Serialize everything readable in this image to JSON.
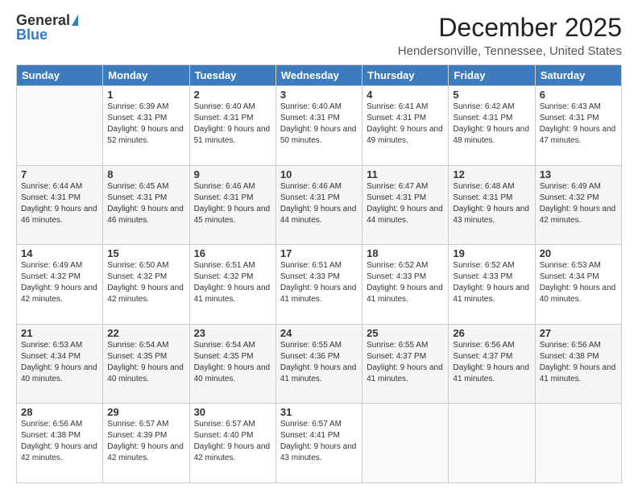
{
  "logo": {
    "general": "General",
    "blue": "Blue"
  },
  "title": "December 2025",
  "location": "Hendersonville, Tennessee, United States",
  "weekdays": [
    "Sunday",
    "Monday",
    "Tuesday",
    "Wednesday",
    "Thursday",
    "Friday",
    "Saturday"
  ],
  "weeks": [
    [
      {
        "day": "",
        "sunrise": "",
        "sunset": "",
        "daylight": ""
      },
      {
        "day": "1",
        "sunrise": "Sunrise: 6:39 AM",
        "sunset": "Sunset: 4:31 PM",
        "daylight": "Daylight: 9 hours and 52 minutes."
      },
      {
        "day": "2",
        "sunrise": "Sunrise: 6:40 AM",
        "sunset": "Sunset: 4:31 PM",
        "daylight": "Daylight: 9 hours and 51 minutes."
      },
      {
        "day": "3",
        "sunrise": "Sunrise: 6:40 AM",
        "sunset": "Sunset: 4:31 PM",
        "daylight": "Daylight: 9 hours and 50 minutes."
      },
      {
        "day": "4",
        "sunrise": "Sunrise: 6:41 AM",
        "sunset": "Sunset: 4:31 PM",
        "daylight": "Daylight: 9 hours and 49 minutes."
      },
      {
        "day": "5",
        "sunrise": "Sunrise: 6:42 AM",
        "sunset": "Sunset: 4:31 PM",
        "daylight": "Daylight: 9 hours and 48 minutes."
      },
      {
        "day": "6",
        "sunrise": "Sunrise: 6:43 AM",
        "sunset": "Sunset: 4:31 PM",
        "daylight": "Daylight: 9 hours and 47 minutes."
      }
    ],
    [
      {
        "day": "7",
        "sunrise": "Sunrise: 6:44 AM",
        "sunset": "Sunset: 4:31 PM",
        "daylight": "Daylight: 9 hours and 46 minutes."
      },
      {
        "day": "8",
        "sunrise": "Sunrise: 6:45 AM",
        "sunset": "Sunset: 4:31 PM",
        "daylight": "Daylight: 9 hours and 46 minutes."
      },
      {
        "day": "9",
        "sunrise": "Sunrise: 6:46 AM",
        "sunset": "Sunset: 4:31 PM",
        "daylight": "Daylight: 9 hours and 45 minutes."
      },
      {
        "day": "10",
        "sunrise": "Sunrise: 6:46 AM",
        "sunset": "Sunset: 4:31 PM",
        "daylight": "Daylight: 9 hours and 44 minutes."
      },
      {
        "day": "11",
        "sunrise": "Sunrise: 6:47 AM",
        "sunset": "Sunset: 4:31 PM",
        "daylight": "Daylight: 9 hours and 44 minutes."
      },
      {
        "day": "12",
        "sunrise": "Sunrise: 6:48 AM",
        "sunset": "Sunset: 4:31 PM",
        "daylight": "Daylight: 9 hours and 43 minutes."
      },
      {
        "day": "13",
        "sunrise": "Sunrise: 6:49 AM",
        "sunset": "Sunset: 4:32 PM",
        "daylight": "Daylight: 9 hours and 42 minutes."
      }
    ],
    [
      {
        "day": "14",
        "sunrise": "Sunrise: 6:49 AM",
        "sunset": "Sunset: 4:32 PM",
        "daylight": "Daylight: 9 hours and 42 minutes."
      },
      {
        "day": "15",
        "sunrise": "Sunrise: 6:50 AM",
        "sunset": "Sunset: 4:32 PM",
        "daylight": "Daylight: 9 hours and 42 minutes."
      },
      {
        "day": "16",
        "sunrise": "Sunrise: 6:51 AM",
        "sunset": "Sunset: 4:32 PM",
        "daylight": "Daylight: 9 hours and 41 minutes."
      },
      {
        "day": "17",
        "sunrise": "Sunrise: 6:51 AM",
        "sunset": "Sunset: 4:33 PM",
        "daylight": "Daylight: 9 hours and 41 minutes."
      },
      {
        "day": "18",
        "sunrise": "Sunrise: 6:52 AM",
        "sunset": "Sunset: 4:33 PM",
        "daylight": "Daylight: 9 hours and 41 minutes."
      },
      {
        "day": "19",
        "sunrise": "Sunrise: 6:52 AM",
        "sunset": "Sunset: 4:33 PM",
        "daylight": "Daylight: 9 hours and 41 minutes."
      },
      {
        "day": "20",
        "sunrise": "Sunrise: 6:53 AM",
        "sunset": "Sunset: 4:34 PM",
        "daylight": "Daylight: 9 hours and 40 minutes."
      }
    ],
    [
      {
        "day": "21",
        "sunrise": "Sunrise: 6:53 AM",
        "sunset": "Sunset: 4:34 PM",
        "daylight": "Daylight: 9 hours and 40 minutes."
      },
      {
        "day": "22",
        "sunrise": "Sunrise: 6:54 AM",
        "sunset": "Sunset: 4:35 PM",
        "daylight": "Daylight: 9 hours and 40 minutes."
      },
      {
        "day": "23",
        "sunrise": "Sunrise: 6:54 AM",
        "sunset": "Sunset: 4:35 PM",
        "daylight": "Daylight: 9 hours and 40 minutes."
      },
      {
        "day": "24",
        "sunrise": "Sunrise: 6:55 AM",
        "sunset": "Sunset: 4:36 PM",
        "daylight": "Daylight: 9 hours and 41 minutes."
      },
      {
        "day": "25",
        "sunrise": "Sunrise: 6:55 AM",
        "sunset": "Sunset: 4:37 PM",
        "daylight": "Daylight: 9 hours and 41 minutes."
      },
      {
        "day": "26",
        "sunrise": "Sunrise: 6:56 AM",
        "sunset": "Sunset: 4:37 PM",
        "daylight": "Daylight: 9 hours and 41 minutes."
      },
      {
        "day": "27",
        "sunrise": "Sunrise: 6:56 AM",
        "sunset": "Sunset: 4:38 PM",
        "daylight": "Daylight: 9 hours and 41 minutes."
      }
    ],
    [
      {
        "day": "28",
        "sunrise": "Sunrise: 6:56 AM",
        "sunset": "Sunset: 4:38 PM",
        "daylight": "Daylight: 9 hours and 42 minutes."
      },
      {
        "day": "29",
        "sunrise": "Sunrise: 6:57 AM",
        "sunset": "Sunset: 4:39 PM",
        "daylight": "Daylight: 9 hours and 42 minutes."
      },
      {
        "day": "30",
        "sunrise": "Sunrise: 6:57 AM",
        "sunset": "Sunset: 4:40 PM",
        "daylight": "Daylight: 9 hours and 42 minutes."
      },
      {
        "day": "31",
        "sunrise": "Sunrise: 6:57 AM",
        "sunset": "Sunset: 4:41 PM",
        "daylight": "Daylight: 9 hours and 43 minutes."
      },
      {
        "day": "",
        "sunrise": "",
        "sunset": "",
        "daylight": ""
      },
      {
        "day": "",
        "sunrise": "",
        "sunset": "",
        "daylight": ""
      },
      {
        "day": "",
        "sunrise": "",
        "sunset": "",
        "daylight": ""
      }
    ]
  ]
}
